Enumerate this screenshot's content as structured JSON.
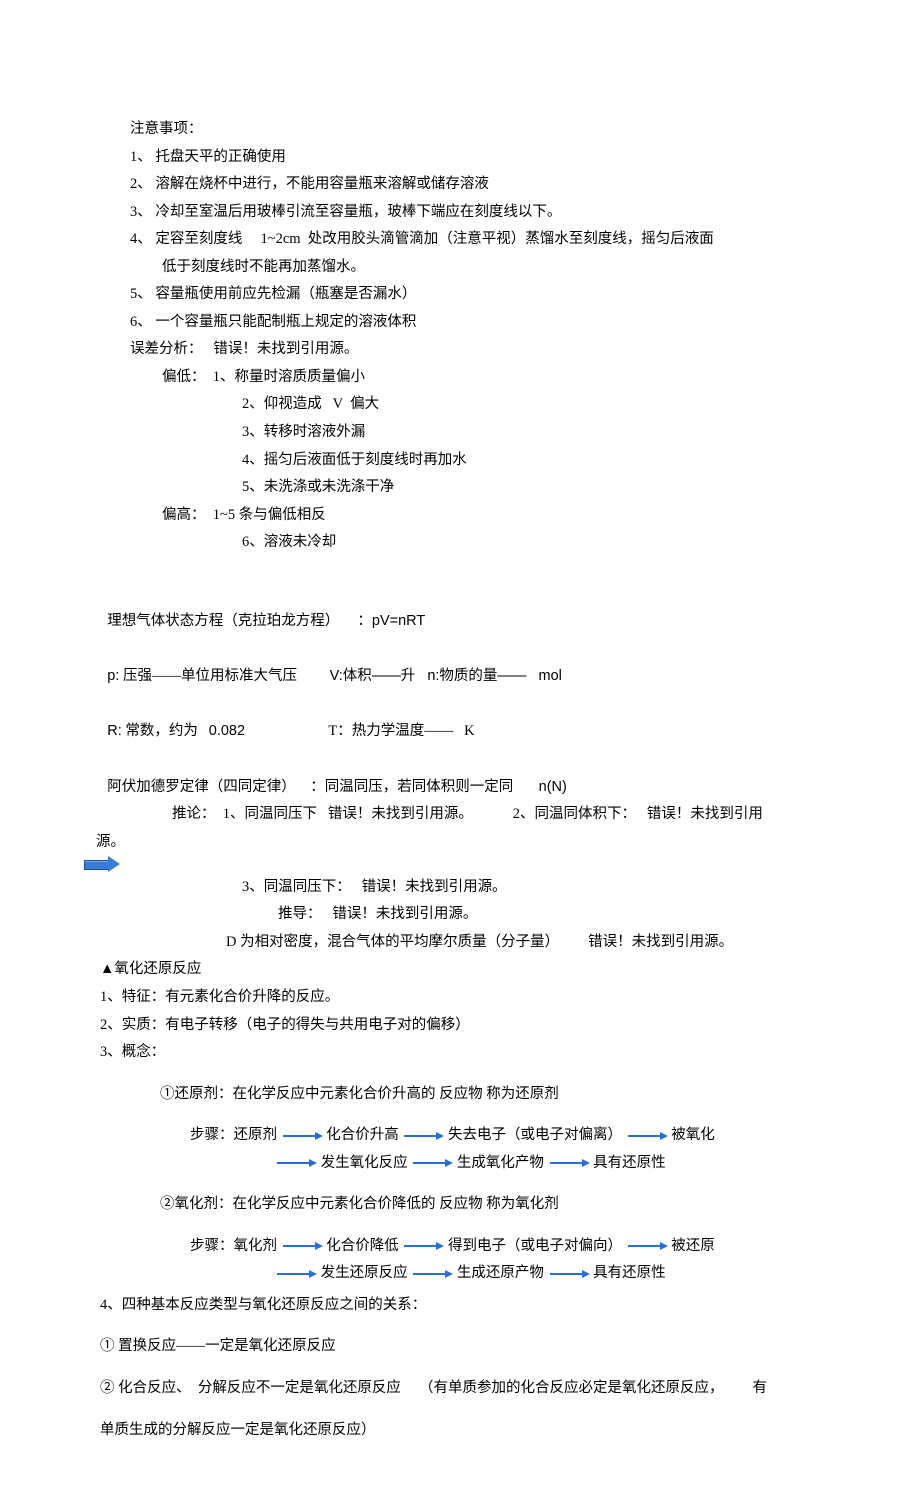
{
  "precautions": {
    "heading": "注意事项：",
    "items": [
      "1、 托盘天平的正确使用",
      "2、 溶解在烧杯中进行，不能用容量瓶来溶解或储存溶液",
      "3、 冷却至室温后用玻棒引流至容量瓶，玻棒下端应在刻度线以下。",
      "4、 定容至刻度线     1~2cm  处改用胶头滴管滴加（注意平视）蒸馏水至刻度线，摇匀后液面",
      "低于刻度线时不能再加蒸馏水。",
      "5、 容量瓶使用前应先检漏（瓶塞是否漏水）",
      "6、 一个容量瓶只能配制瓶上规定的溶液体积"
    ]
  },
  "error_analysis": {
    "heading": "误差分析：   错误！未找到引用源。",
    "low_heading": "偏低：  1、称量时溶质质量偏小",
    "low_items": [
      "2、仰视造成   V  偏大",
      "3、转移时溶液外漏",
      "4、摇匀后液面低于刻度线时再加水",
      "5、未洗涤或未洗涤干净"
    ],
    "high_heading": "偏高：  1~5 条与偏低相反",
    "high_items": [
      "6、溶液未冷却"
    ]
  },
  "ideal_gas": {
    "line1_a": "理想气体状态方程（克拉珀龙方程）     ：",
    "line1_b": "pV=nRT",
    "line2_a": "p:",
    "line2_b": "压强——单位用标准大气压",
    "line2_c": "V:体积——升   n:物质的量——   mol",
    "line3_a": "R:",
    "line3_b": "常数，约为",
    "line3_c": "0.082",
    "line3_d": "T：热力学温度——   K"
  },
  "avogadro": {
    "line1_a": "阿伏加德罗定律（四同定律）    ：同温同压，若同体积则一定同",
    "line1_b": "n(N)",
    "line2": "推论：  1、同温同压下   错误！未找到引用源。           2、同温同体积下：   错误！未找到引用",
    "line2b": "源。",
    "line3": "3、同温同压下：   错误！未找到引用源。",
    "line4": "推导：   错误！未找到引用源。",
    "line5": "D 为相对密度，混合气体的平均摩尔质量（分子量）        错误！未找到引用源。"
  },
  "redox": {
    "heading": "▲氧化还原反应",
    "item1": "1、特征：有元素化合价升降的反应。",
    "item2": "2、实质：有电子转移（电子的得失与共用电子对的偏移）",
    "item3": "3、概念：",
    "c1_heading": "①还原剂：在化学反应中元素化合价升高的      反应物  称为还原剂",
    "c1_step_label": "步骤：还原剂",
    "c1_s1": "化合价升高",
    "c1_s2": "失去电子（或电子对偏离）",
    "c1_s3": "被氧化",
    "c1_s4": "发生氧化反应",
    "c1_s5": "生成氧化产物",
    "c1_s6": "具有还原性",
    "c2_heading": "②氧化剂：在化学反应中元素化合价降低的      反应物  称为氧化剂",
    "c2_step_label": "步骤：氧化剂",
    "c2_s1": "化合价降低",
    "c2_s2": "得到电子（或电子对偏向）",
    "c2_s3": "被还原",
    "c2_s4": "发生还原反应",
    "c2_s5": "生成还原产物",
    "c2_s6": "具有还原性",
    "item4": "4、四种基本反应类型与氧化还原反应之间的关系：",
    "rel1": "① 置换反应——一定是氧化还原反应",
    "rel2": "② 化合反应、  分解反应不一定是氧化还原反应     （有单质参加的化合反应必定是氧化还原反应，        有",
    "rel2b": "单质生成的分解反应一定是氧化还原反应）"
  }
}
